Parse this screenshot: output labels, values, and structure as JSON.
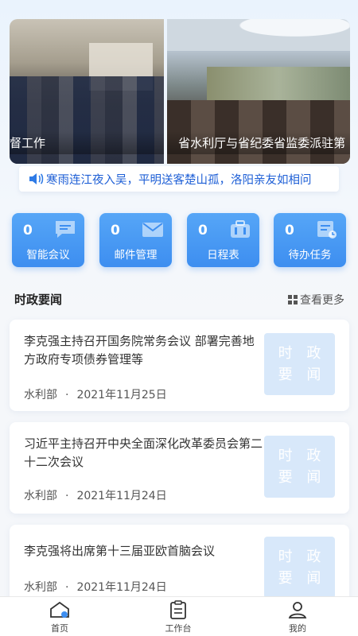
{
  "banner": {
    "slides": [
      {
        "caption": "督工作"
      },
      {
        "caption": "省水利厅与省纪委省监委派驻第"
      }
    ]
  },
  "notice": {
    "text": "寒雨连江夜入吴，平明送客楚山孤，洛阳亲友如相问"
  },
  "quick_actions": [
    {
      "count": "0",
      "label": "智能会议",
      "icon": "chat-icon"
    },
    {
      "count": "0",
      "label": "邮件管理",
      "icon": "mail-icon"
    },
    {
      "count": "0",
      "label": "日程表",
      "icon": "briefcase-icon"
    },
    {
      "count": "0",
      "label": "待办任务",
      "icon": "task-icon"
    }
  ],
  "section": {
    "title": "时政要闻",
    "more_label": "查看更多"
  },
  "news": [
    {
      "title": "李克强主持召开国务院常务会议 部署完善地方政府专项债券管理等",
      "source": "水利部",
      "date": "2021年11月25日",
      "thumb_label": "时 政 要 闻"
    },
    {
      "title": "习近平主持召开中央全面深化改革委员会第二十二次会议",
      "source": "水利部",
      "date": "2021年11月24日",
      "thumb_label": "时 政 要 闻"
    },
    {
      "title": "李克强将出席第十三届亚欧首脑会议",
      "source": "水利部",
      "date": "2021年11月24日",
      "thumb_label": "时 政 要 闻"
    }
  ],
  "meta_separator": "·",
  "tabbar": [
    {
      "label": "首页",
      "icon": "home-icon",
      "active": true
    },
    {
      "label": "工作台",
      "icon": "clipboard-icon",
      "active": false
    },
    {
      "label": "我的",
      "icon": "profile-icon",
      "active": false
    }
  ],
  "colors": {
    "accent": "#3d8ef0",
    "notice_text": "#1e5fd6",
    "thumb_bg": "#d8e8fa"
  }
}
